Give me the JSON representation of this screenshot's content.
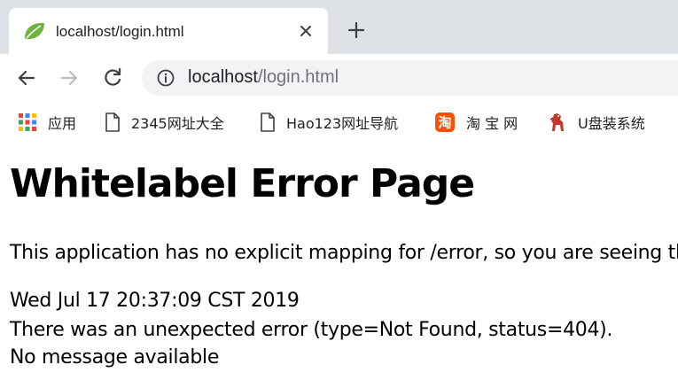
{
  "tab": {
    "title": "localhost/login.html",
    "favicon": "spring-leaf-icon"
  },
  "toolbar": {
    "url_host": "localhost",
    "url_path": "/login.html"
  },
  "bookmarks": [
    {
      "label": "应用",
      "icon": "apps-grid-icon"
    },
    {
      "label": "2345网址大全",
      "icon": "page-icon"
    },
    {
      "label": "Hao123网址导航",
      "icon": "page-icon"
    },
    {
      "label": "淘 宝 网",
      "icon": "taobao-icon"
    },
    {
      "label": "U盘装系统",
      "icon": "horse-icon"
    }
  ],
  "page": {
    "heading": "Whitelabel Error Page",
    "explanation": "This application has no explicit mapping for /error, so you are seeing this as a fallback.",
    "timestamp": "Wed Jul 17 20:37:09 CST 2019",
    "error_line": "There was an unexpected error (type=Not Found, status=404).",
    "message": "No message available"
  },
  "colors": {
    "tabstrip_bg": "#dee1e6",
    "omnibox_bg": "#f1f3f4",
    "spring_green": "#6db33f",
    "taobao_orange": "#ff5000"
  }
}
